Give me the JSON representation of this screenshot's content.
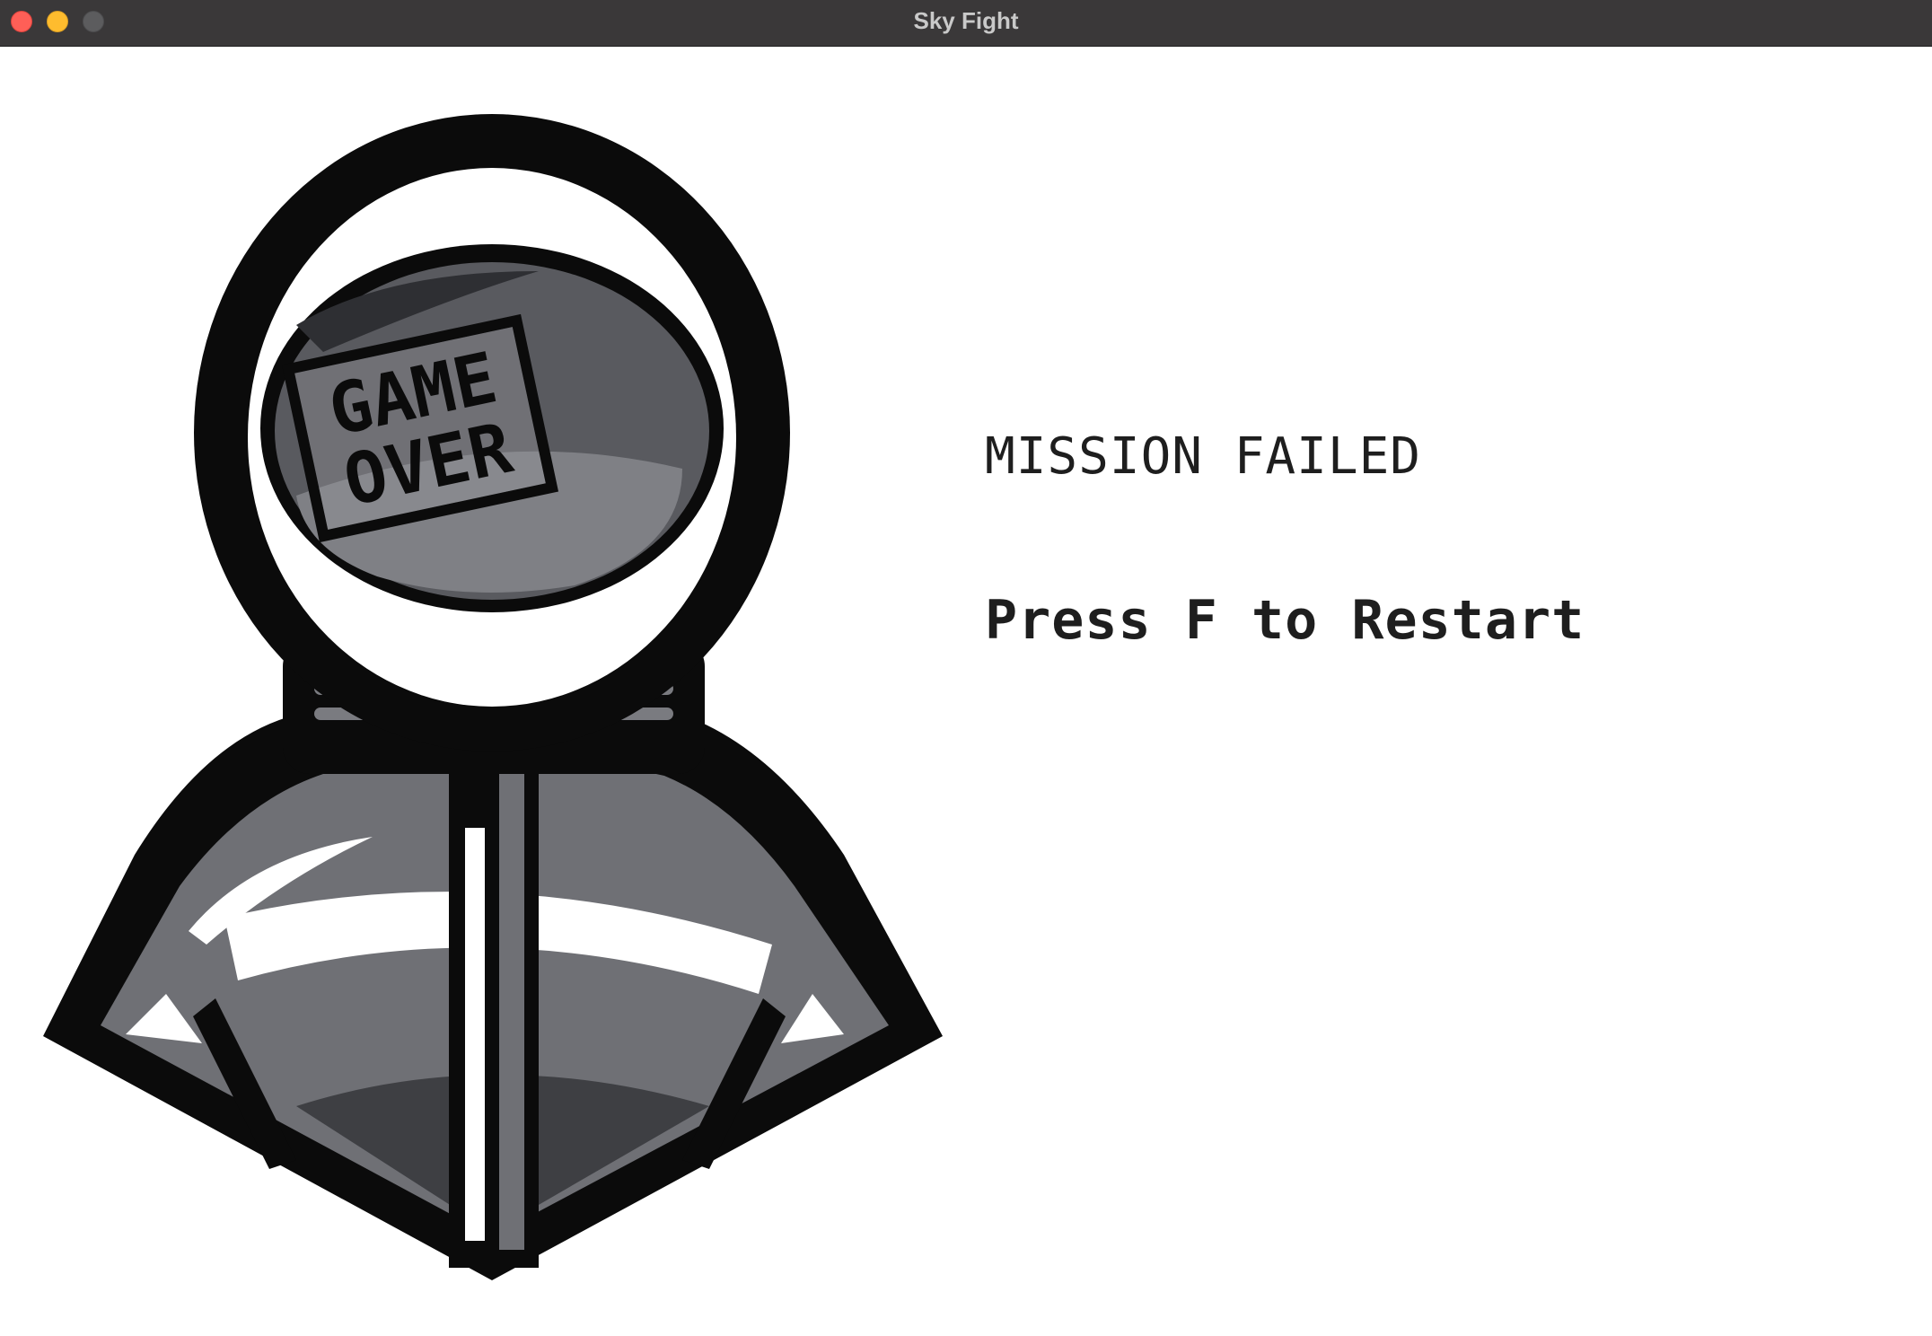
{
  "window": {
    "title": "Sky Fight",
    "controls": {
      "close": "close-button",
      "minimize": "minimize-button",
      "zoom": "zoom-button"
    }
  },
  "game": {
    "screen": "game-over",
    "headline": "MISSION FAILED",
    "prompt": "Press F to Restart",
    "visor_badge": {
      "line1": "GAME",
      "line2": "OVER"
    }
  },
  "colors": {
    "background": "#ffffff",
    "text": "#1e1e1e",
    "titlebar": "#3a3839",
    "close": "#ff5f57",
    "minimize": "#febc2e",
    "zoom": "#5c5c5e"
  }
}
